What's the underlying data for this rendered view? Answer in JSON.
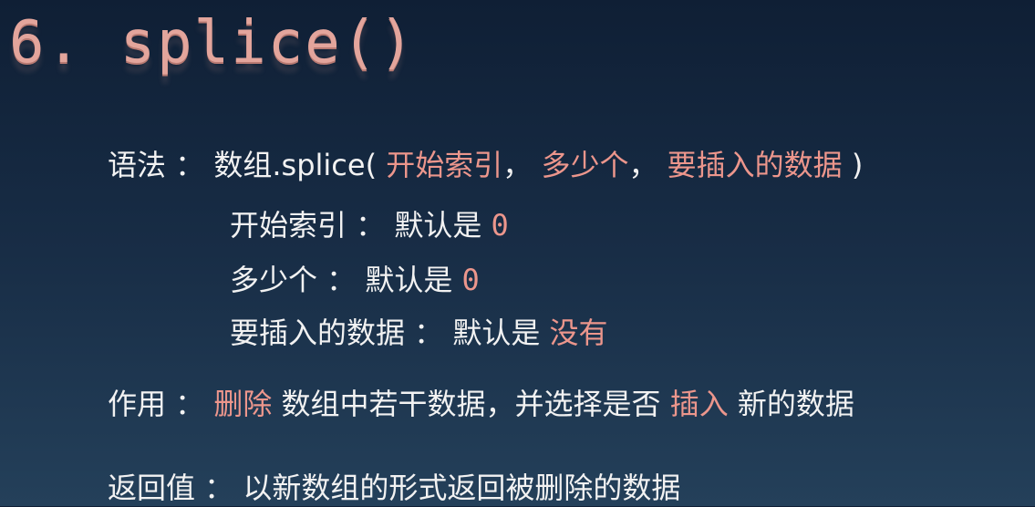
{
  "title": "6. splice()",
  "syntax": {
    "label": "语法 ：",
    "code": "数组.splice(",
    "param1": "开始索引",
    "sep1": "，",
    "param2": "多少个",
    "sep2": "，",
    "param3": "要插入的数据",
    "close": ")"
  },
  "params": [
    {
      "label": "开始索引 ： 默认是",
      "value": "0"
    },
    {
      "label": "多少个 ： 默认是",
      "value": "0"
    },
    {
      "label": "要插入的数据 ： 默认是",
      "value": "没有"
    }
  ],
  "effect": {
    "label": "作用 ：",
    "hl1": "删除",
    "text1": "数组中若干数据，并选择是否",
    "hl2": "插入",
    "text2": "新的数据"
  },
  "returns": {
    "label": "返回值 ：",
    "text": "以新数组的形式返回被删除的数据"
  },
  "colors": {
    "highlight": "#ec968c",
    "title": "#e3a59c",
    "background": "#182d46"
  }
}
